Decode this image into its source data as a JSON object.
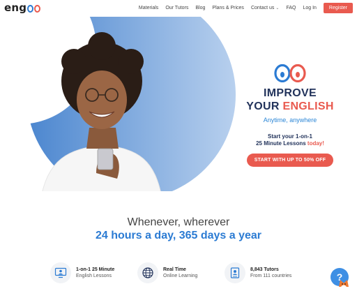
{
  "header": {
    "logo_text": "eng",
    "nav": {
      "materials": "Materials",
      "tutors": "Our Tutors",
      "blog": "Blog",
      "plans": "Plans & Prices",
      "contact": "Contact us",
      "faq": "FAQ",
      "login": "Log In"
    },
    "register": "Register"
  },
  "hero": {
    "headline_line1": "IMPROVE",
    "headline_line2_a": "YOUR",
    "headline_line2_b": "ENGLISH",
    "tagline": "Anytime, anywhere",
    "start_line1": "Start your 1-on-1",
    "start_line2_a": "25 Minute Lessons",
    "start_line2_b": "today!",
    "cta": "START WITH UP TO 50% OFF"
  },
  "section": {
    "subtitle": "Whenever, wherever",
    "title": "24 hours a day, 365 days a year"
  },
  "features": [
    {
      "icon": "monitor-icon",
      "title": "1-on-1 25 Minute",
      "subtitle": "English Lessons"
    },
    {
      "icon": "globe-icon",
      "title": "Real Time",
      "subtitle": "Online Learning"
    },
    {
      "icon": "tutor-badge-icon",
      "title": "8,843 Tutors",
      "subtitle": "From 111 countries"
    }
  ],
  "help_label": "?",
  "colors": {
    "brand_blue": "#2b7bd3",
    "brand_red": "#e95a4f",
    "navy": "#22335b"
  }
}
